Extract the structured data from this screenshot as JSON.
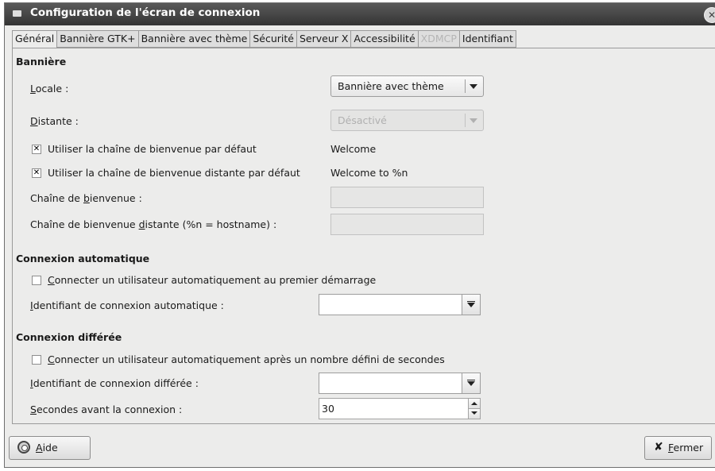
{
  "window": {
    "title": "Configuration de l'écran de connexion",
    "close_glyph": "✕"
  },
  "tabs": [
    {
      "label": "Général",
      "active": true
    },
    {
      "label": "Bannière GTK+"
    },
    {
      "label": "Bannière avec thème"
    },
    {
      "label": "Sécurité"
    },
    {
      "label": "Serveur X"
    },
    {
      "label": "Accessibilité"
    },
    {
      "label": "XDMCP",
      "disabled": true
    },
    {
      "label": "Identifiant"
    }
  ],
  "banner": {
    "section_title": "Bannière",
    "local_label_u": "L",
    "local_label_rest": "ocale :",
    "local_value": "Bannière avec thème",
    "remote_label_u": "D",
    "remote_label_rest": "istante :",
    "remote_value": "Désactivé",
    "default_welcome_check": "Utiliser la chaîne de bienvenue par défaut",
    "default_welcome_value": "Welcome",
    "default_remote_welcome_check": "Utiliser la chaîne de bienvenue distante par défaut",
    "default_remote_welcome_value": "Welcome to %n",
    "welcome_label_a": "Chaîne de ",
    "welcome_label_u": "b",
    "welcome_label_b": "ienvenue :",
    "remote_welcome_label_a": "Chaîne de bienvenue ",
    "remote_welcome_label_u": "d",
    "remote_welcome_label_b": "istante (%n = hostname) :"
  },
  "auto_login": {
    "section_title": "Connexion automatique",
    "check_u": "C",
    "check_rest": "onnecter un utilisateur automatiquement au premier démarrage",
    "login_label_u": "I",
    "login_label_rest": "dentifiant de connexion automatique :",
    "login_value": ""
  },
  "timed_login": {
    "section_title": "Connexion différée",
    "check_u": "C",
    "check_rest": "onnecter un utilisateur automatiquement après un nombre défini de secondes",
    "login_label_u": "I",
    "login_label_rest": "dentifiant de connexion différée :",
    "login_value": "",
    "seconds_label_u": "S",
    "seconds_label_rest": "econdes avant la connexion :",
    "seconds_value": "30"
  },
  "footer": {
    "help_u": "A",
    "help_rest": "ide",
    "close_glyph": "✘",
    "close_u": "F",
    "close_rest": "ermer"
  }
}
